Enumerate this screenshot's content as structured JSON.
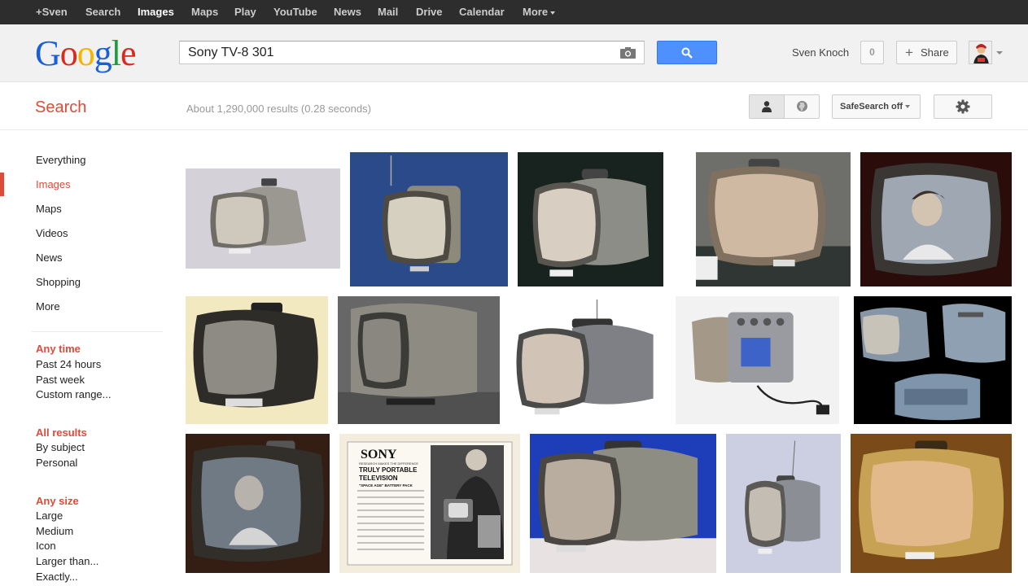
{
  "topbar": {
    "items": [
      "+Sven",
      "Search",
      "Images",
      "Maps",
      "Play",
      "YouTube",
      "News",
      "Mail",
      "Drive",
      "Calendar",
      "More"
    ],
    "active": "Images"
  },
  "logo": [
    "G",
    "o",
    "o",
    "g",
    "l",
    "e"
  ],
  "search": {
    "query": "Sony TV-8 301"
  },
  "user": {
    "name": "Sven Knoch",
    "notifications": "0",
    "share_label": "Share"
  },
  "subheader": {
    "title": "Search",
    "result_stats": "About 1,290,000 results (0.28 seconds)",
    "safesearch": "SafeSearch off"
  },
  "leftnav": {
    "items": [
      "Everything",
      "Images",
      "Maps",
      "Videos",
      "News",
      "Shopping",
      "More"
    ],
    "selected": "Images"
  },
  "filters": {
    "time": {
      "title": "Any time",
      "options": [
        "Past 24 hours",
        "Past week",
        "Custom range..."
      ]
    },
    "results": {
      "title": "All results",
      "options": [
        "By subject",
        "Personal"
      ]
    },
    "size": {
      "title": "Any size",
      "options": [
        "Large",
        "Medium",
        "Icon",
        "Larger than...",
        "Exactly..."
      ]
    }
  },
  "images": {
    "ad": {
      "brand": "SONY",
      "tagline": "RESEARCH MAKES THE DIFFERENCE",
      "headline_1": "TRULY PORTABLE",
      "headline_2": "TELEVISION",
      "headline_3": "\"SPACE AGE\" BATTERY PACK"
    }
  },
  "colors": {
    "accent": "#dd4b39",
    "topbar": "#2d2d2d",
    "search_button": "#4d90fe",
    "logo": [
      "#1a5fd8",
      "#d92b1c",
      "#f4b400",
      "#1a5fd8",
      "#1e9b3c",
      "#d92b1c"
    ]
  }
}
